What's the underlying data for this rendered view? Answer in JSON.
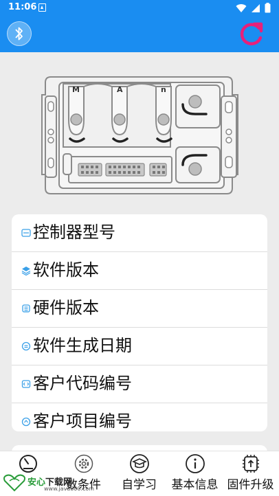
{
  "status_bar": {
    "time": "11:06",
    "icons": [
      "notification-icon",
      "wifi-icon",
      "signal-icon",
      "battery-icon"
    ]
  },
  "app_bar": {
    "color": "#1a8df1",
    "left_icon": "bluetooth-icon",
    "right_icon": "refresh-icon",
    "refresh_color": "#e8207a"
  },
  "device_image": {
    "port_labels": [
      "M",
      "A",
      "n"
    ]
  },
  "info_list": {
    "items": [
      {
        "label": "控制器型号",
        "icon": "model-icon"
      },
      {
        "label": "软件版本",
        "icon": "layers-icon"
      },
      {
        "label": "硬件版本",
        "icon": "hardware-icon"
      },
      {
        "label": "软件生成日期",
        "icon": "date-icon"
      },
      {
        "label": "客户代码编号",
        "icon": "code-icon"
      },
      {
        "label": "客户项目编号",
        "icon": "project-icon"
      }
    ]
  },
  "bottom_nav": {
    "items": [
      {
        "label": "",
        "icon": "gauge-icon"
      },
      {
        "label": "数条件",
        "icon": "gear-icon"
      },
      {
        "label": "自学习",
        "icon": "graduation-cap-icon"
      },
      {
        "label": "基本信息",
        "icon": "info-icon"
      },
      {
        "label": "固件升级",
        "icon": "chip-upgrade-icon"
      }
    ]
  },
  "watermark": {
    "brand_green": "安心",
    "brand_dark": "下载网",
    "url": "www.java800.com"
  }
}
